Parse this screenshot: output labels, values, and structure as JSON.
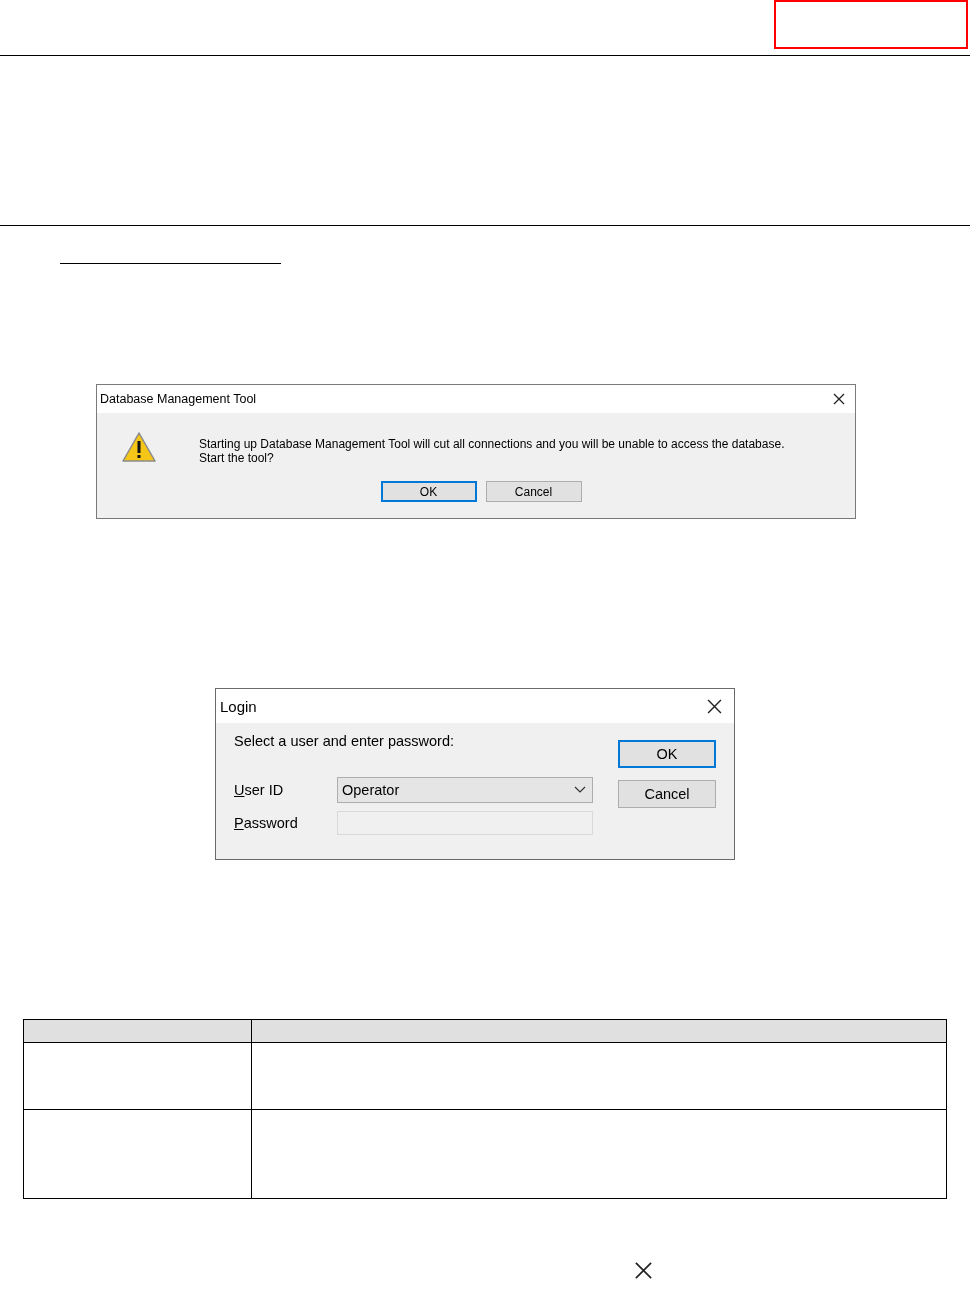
{
  "confirm_dialog": {
    "title": "Database Management Tool",
    "message": "Starting up Database Management Tool will cut all connections and you will be unable to access the database.\nStart the tool?",
    "buttons": [
      {
        "label": "OK",
        "focused": true
      },
      {
        "label": "Cancel",
        "focused": false
      }
    ]
  },
  "login_dialog": {
    "title": "Login",
    "prompt": "Select a user and enter password:",
    "fields": [
      {
        "kind": "dropdown",
        "label": "User ID",
        "first_letter_underlined": true,
        "value": "Operator"
      },
      {
        "kind": "password",
        "label": "Password",
        "first_letter_underlined": true
      }
    ],
    "buttons": [
      {
        "label": "OK",
        "focused": true
      },
      {
        "label": "Cancel",
        "focused": false
      }
    ]
  }
}
